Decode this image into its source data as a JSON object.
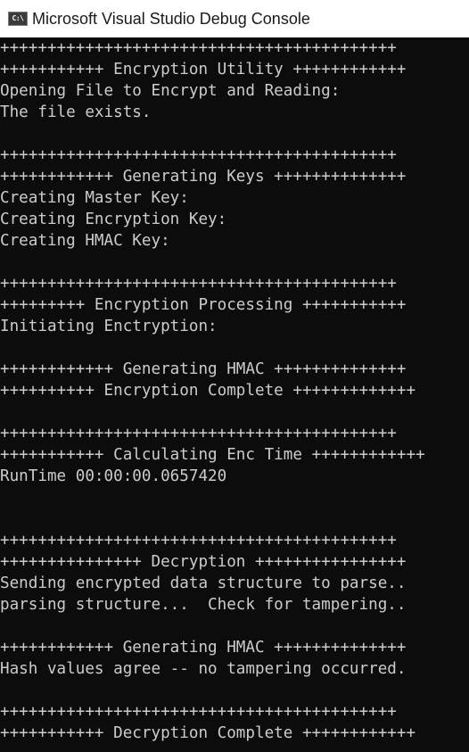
{
  "window": {
    "title": "Microsoft Visual Studio Debug Console",
    "icon": "console-app-icon",
    "icon_text": "C:\\"
  },
  "console": {
    "lines": [
      "++++++++++++++++++++++++++++++++++++++++++",
      "+++++++++++ Encryption Utility ++++++++++++",
      "Opening File to Encrypt and Reading:",
      "The file exists.",
      "",
      "++++++++++++++++++++++++++++++++++++++++++",
      "++++++++++++ Generating Keys ++++++++++++++",
      "Creating Master Key:",
      "Creating Encryption Key:",
      "Creating HMAC Key:",
      "",
      "++++++++++++++++++++++++++++++++++++++++++",
      "+++++++++ Encryption Processing +++++++++++",
      "Initiating Enctryption:",
      "",
      "++++++++++++ Generating HMAC ++++++++++++++",
      "++++++++++ Encryption Complete +++++++++++++",
      "",
      "++++++++++++++++++++++++++++++++++++++++++",
      "+++++++++++ Calculating Enc Time ++++++++++++",
      "RunTime 00:00:00.0657420",
      "",
      "",
      "++++++++++++++++++++++++++++++++++++++++++",
      "+++++++++++++++ Decryption ++++++++++++++++",
      "Sending encrypted data structure to parse..",
      "parsing structure...  Check for tampering..",
      "",
      "++++++++++++ Generating HMAC ++++++++++++++",
      "Hash values agree -- no tampering occurred.",
      "",
      "++++++++++++++++++++++++++++++++++++++++++",
      "+++++++++++ Decryption Complete ++++++++++++"
    ]
  }
}
